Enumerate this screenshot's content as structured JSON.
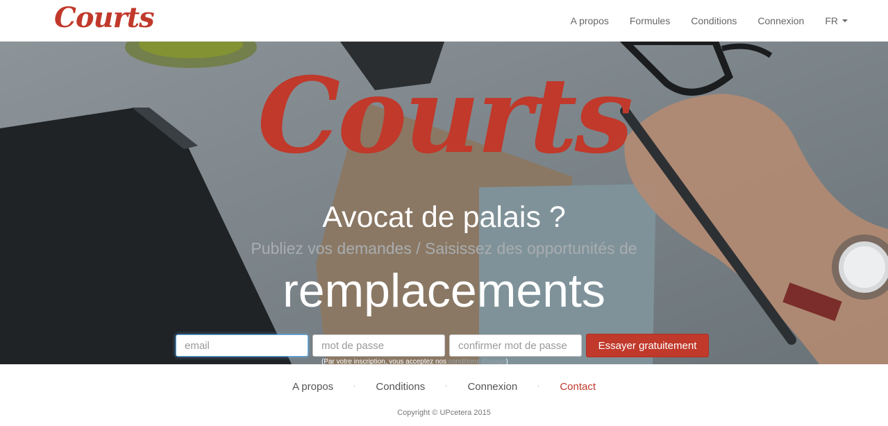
{
  "brand": "Courts",
  "navbar": {
    "links": [
      "A propos",
      "Formules",
      "Conditions",
      "Connexion"
    ],
    "language": "FR"
  },
  "hero": {
    "logo": "Courts",
    "title": "Avocat de palais ?",
    "subtitle": "Publiez vos demandes / Saisissez des opportunités de",
    "highlight": "remplacements"
  },
  "signup": {
    "email_placeholder": "email",
    "password_placeholder": "mot de passe",
    "confirm_placeholder": "confirmer mot de passe",
    "submit_label": "Essayer gratuitement",
    "terms_prefix": "(Par votre inscription, vous acceptez nos",
    "terms_link": "conditions d'usage",
    "terms_suffix": ")"
  },
  "footer": {
    "links": [
      "A propos",
      "Conditions",
      "Connexion",
      "Contact"
    ],
    "copyright": "Copyright © UPcetera 2015"
  },
  "colors": {
    "accent": "#c0392b",
    "navbar_bg": "#ffffff",
    "hero_overlay": "#5f676d"
  }
}
